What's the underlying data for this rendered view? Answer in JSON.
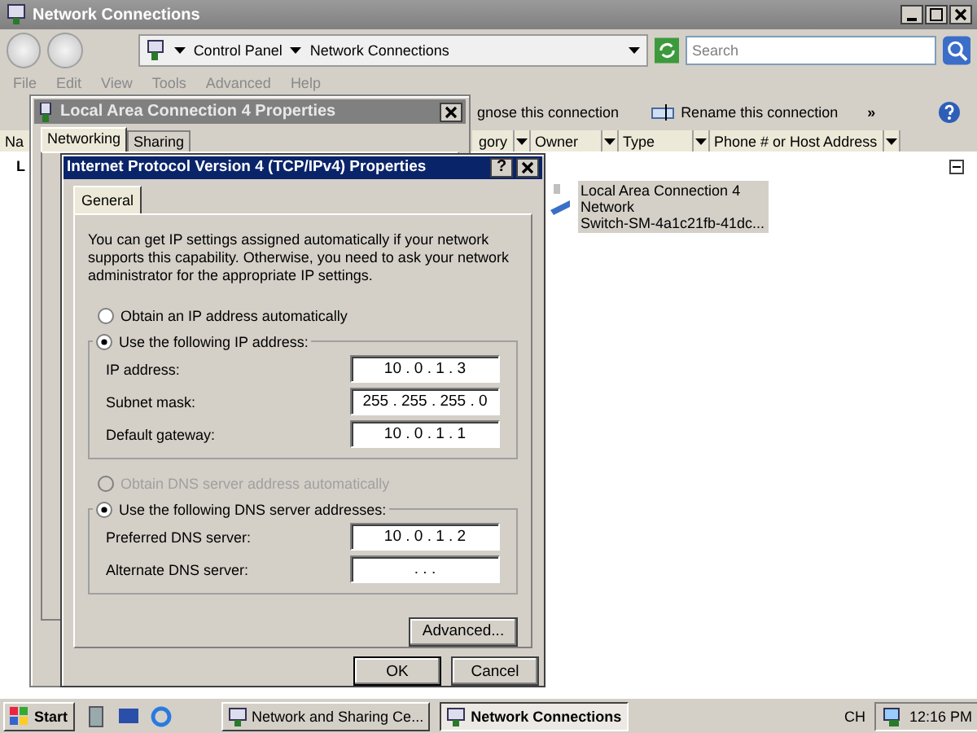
{
  "explorer": {
    "title": "Network Connections",
    "breadcrumb": [
      "Control Panel",
      "Network Connections"
    ],
    "search": {
      "placeholder": "Search"
    },
    "menu": [
      "File",
      "Edit",
      "View",
      "Tools",
      "Advanced",
      "Help"
    ],
    "toolbar": [
      "gnose this connection",
      "Rename this connection"
    ],
    "more": "»",
    "columns": [
      "Na",
      "gory",
      "Owner",
      "Type",
      "Phone # or Host Address"
    ],
    "list_fragment": "L",
    "item": {
      "lines": [
        "Local Area Connection 4",
        "Network",
        "Switch-SM-4a1c21fb-41dc..."
      ],
      "selected": true
    }
  },
  "properties": {
    "title": "Local Area Connection 4 Properties",
    "tabs": [
      {
        "label": "Networking",
        "selected": true
      },
      {
        "label": "Sharing",
        "selected": false
      }
    ]
  },
  "ipv4": {
    "title": "Internet Protocol Version 4 (TCP/IPv4) Properties",
    "help": "?",
    "tabs": [
      {
        "label": "General",
        "selected": true
      }
    ],
    "intro": "You can get IP settings assigned automatically if your network supports this capability. Otherwise, you need to ask your network administrator for the appropriate IP settings.",
    "ip_options": [
      {
        "label": "Obtain an IP address automatically",
        "selected": false,
        "disabled": false
      },
      {
        "label": "Use the following IP address:",
        "selected": true,
        "disabled": false
      }
    ],
    "ip_fields": [
      {
        "label": "IP address:",
        "value": "10 . 0 . 1 . 3"
      },
      {
        "label": "Subnet mask:",
        "value": "255 . 255 . 255 . 0"
      },
      {
        "label": "Default gateway:",
        "value": "10 . 0 . 1 . 1"
      }
    ],
    "dns_options": [
      {
        "label": "Obtain DNS server address automatically",
        "selected": false,
        "disabled": true
      },
      {
        "label": "Use the following DNS server addresses:",
        "selected": true,
        "disabled": false
      }
    ],
    "dns_fields": [
      {
        "label": "Preferred DNS server:",
        "value": "10 . 0 . 1 . 2"
      },
      {
        "label": "Alternate DNS server:",
        "value": ". . ."
      }
    ],
    "buttons": [
      "Advanced...",
      "OK",
      "Cancel"
    ]
  },
  "taskbar": {
    "start": "Start",
    "tasks": [
      {
        "label": "Network and Sharing Ce...",
        "selected": false
      },
      {
        "label": "Network Connections",
        "selected": true
      }
    ],
    "language": "CH",
    "clock": "12:16 PM"
  }
}
